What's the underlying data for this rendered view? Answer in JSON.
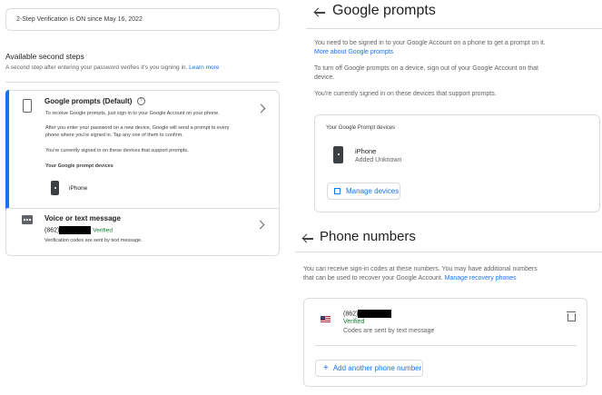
{
  "left": {
    "status_text": "2-Step Verification is ON since May 16, 2022",
    "available_title": "Available second steps",
    "available_desc": "A second step after entering your password verifies it's you signing in.",
    "learn_more": "Learn more",
    "prompts": {
      "title": "Google prompts (Default)",
      "line1": "To receive Google prompts, just sign in to your Google Account on your phone.",
      "line2a": "After you enter your password on a new device, Google will send a prompt to every",
      "line2b": "phone where you're signed in. Tap any one of them to confirm.",
      "line3": "You're currently signed in on these devices that support prompts.",
      "devices_label": "Your Google prompt devices",
      "device_name": "iPhone"
    },
    "voice": {
      "title": "Voice or text message",
      "number_prefix": "(862)",
      "verified": "Verified",
      "desc": "Verification codes are sent by text message."
    }
  },
  "right": {
    "prompts": {
      "title": "Google prompts",
      "p1": "You need to be signed in to your Google Account on a phone to get a prompt on it.",
      "p1_link": "More about Google prompts",
      "p2a": "To turn off Google prompts on a device, sign out of your Google Account on that",
      "p2b": "device.",
      "p3": "You're currently signed in on these devices that support prompts.",
      "devices_label": "Your Google Prompt devices",
      "device_name": "iPhone",
      "device_added": "Added Unknown",
      "manage_label": "Manage devices"
    },
    "phones": {
      "title": "Phone numbers",
      "p1a": "You can receive sign-in codes at these numbers. You may have additional numbers",
      "p1b": "that can be used to recover your Google Account.",
      "p1_link": "Manage recovery phones",
      "number_prefix": "(862)",
      "verified": "Verified",
      "codes_desc": "Codes are sent by text message",
      "add_label": "Add another phone number"
    }
  },
  "colors": {
    "accent": "#1a73e8",
    "verified": "#188038",
    "selected_bar": "#1a73e8"
  }
}
